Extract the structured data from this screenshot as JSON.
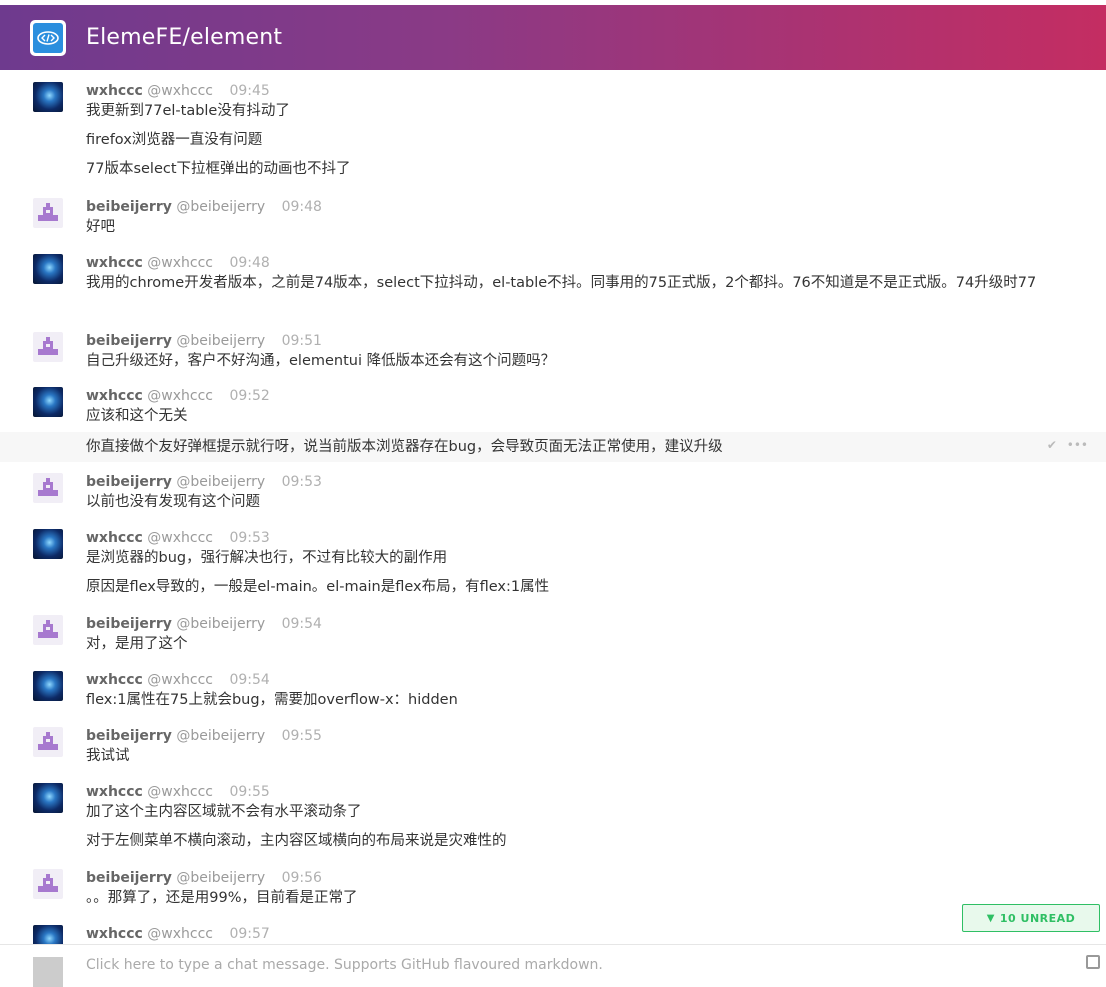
{
  "room": {
    "name": "ElemeFE/element",
    "icon": "code-brackets-icon"
  },
  "users": {
    "wxhccc": {
      "name": "wxhccc",
      "handle": "@wxhccc"
    },
    "beibeijerry": {
      "name": "beibeijerry",
      "handle": "@beibeijerry"
    }
  },
  "messages": [
    {
      "author": "wxhccc",
      "handle": "@wxhccc",
      "time": "09:45",
      "lines": [
        "我更新到77el-table没有抖动了",
        "firefox浏览器一直没有问题",
        "77版本select下拉框弹出的动画也不抖了"
      ]
    },
    {
      "author": "beibeijerry",
      "handle": "@beibeijerry",
      "time": "09:48",
      "lines": [
        "好吧"
      ]
    },
    {
      "author": "wxhccc",
      "handle": "@wxhccc",
      "time": "09:48",
      "lines": [
        "我用的chrome开发者版本，之前是74版本，select下拉抖动，el-table不抖。同事用的75正式版，2个都抖。76不知道是不是正式版。74升级时77"
      ]
    },
    {
      "author": "beibeijerry",
      "handle": "@beibeijerry",
      "time": "09:51",
      "lines": [
        "自己升级还好，客户不好沟通，elementui 降低版本还会有这个问题吗？"
      ]
    },
    {
      "author": "wxhccc",
      "handle": "@wxhccc",
      "time": "09:52",
      "lines": [
        "应该和这个无关",
        "你直接做个友好弹框提示就行呀，说当前版本浏览器存在bug，会导致页面无法正常使用，建议升级"
      ]
    },
    {
      "author": "beibeijerry",
      "handle": "@beibeijerry",
      "time": "09:53",
      "lines": [
        "以前也没有发现有这个问题"
      ]
    },
    {
      "author": "wxhccc",
      "handle": "@wxhccc",
      "time": "09:53",
      "lines": [
        "是浏览器的bug，强行解决也行，不过有比较大的副作用",
        "原因是flex导致的，一般是el-main。el-main是flex布局，有flex:1属性"
      ]
    },
    {
      "author": "beibeijerry",
      "handle": "@beibeijerry",
      "time": "09:54",
      "lines": [
        "对，是用了这个"
      ]
    },
    {
      "author": "wxhccc",
      "handle": "@wxhccc",
      "time": "09:54",
      "lines": [
        "flex:1属性在75上就会bug，需要加overflow-x：hidden"
      ]
    },
    {
      "author": "beibeijerry",
      "handle": "@beibeijerry",
      "time": "09:55",
      "lines": [
        "我试试"
      ]
    },
    {
      "author": "wxhccc",
      "handle": "@wxhccc",
      "time": "09:55",
      "lines": [
        "加了这个主内容区域就不会有水平滚动条了",
        "对于左侧菜单不横向滚动，主内容区域横向的布局来说是灾难性的"
      ]
    },
    {
      "author": "beibeijerry",
      "handle": "@beibeijerry",
      "time": "09:56",
      "lines": [
        "。。那算了，还是用99%，目前看是正常了"
      ]
    },
    {
      "author": "wxhccc",
      "handle": "@wxhccc",
      "time": "09:57",
      "lines": []
    }
  ],
  "unread": {
    "label": "10 UNREAD",
    "icon": "chevron-down-icon",
    "color": "#2fbf64"
  },
  "composer": {
    "placeholder": "Click here to type a chat message. Supports GitHub flavoured markdown."
  },
  "colors": {
    "header_start": "#6e3a8e",
    "header_end": "#c42d62",
    "author": "#666666",
    "time": "#b0b0b0"
  }
}
